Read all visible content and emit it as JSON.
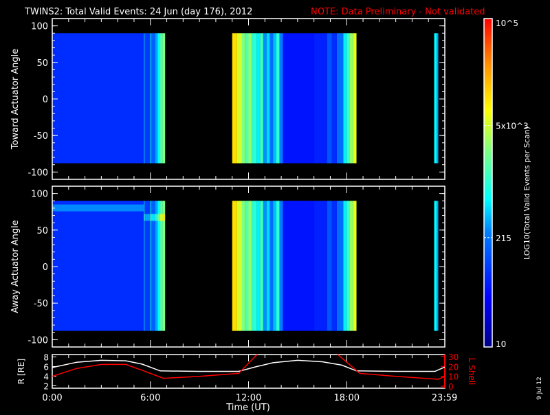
{
  "chart_data": {
    "type": "heatmap",
    "title": "TWINS2: Total Valid Events: 24 Jun (day 176), 2012",
    "note": "NOTE: Data Preliminary - Not validated",
    "xlabel": "Time (UT)",
    "x_ticks": [
      "0:00",
      "6:00",
      "12:00",
      "18:00",
      "23:59"
    ],
    "x_tick_hours": [
      0,
      6,
      12,
      18,
      23.98
    ],
    "xlim_hours": [
      0,
      24
    ],
    "panels": [
      {
        "ylabel": "Toward Actuator Angle",
        "ylim": [
          -110,
          110
        ],
        "y_ticks": [
          "100",
          "50",
          "0",
          "-50",
          "-100"
        ],
        "y_tick_values": [
          100,
          50,
          0,
          -50,
          -100
        ],
        "band": false
      },
      {
        "ylabel": "Away Actuator Angle",
        "ylim": [
          -110,
          110
        ],
        "y_ticks": [
          "100",
          "50",
          "0",
          "-50",
          "-100"
        ],
        "y_tick_values": [
          100,
          50,
          0,
          -50,
          -100
        ],
        "band": true
      }
    ],
    "angle_range": [
      -88,
      90
    ],
    "segments_hours_level": [
      [
        0,
        5.6,
        0.22
      ],
      [
        5.6,
        5.65,
        0.4
      ],
      [
        5.65,
        6.0,
        0.24
      ],
      [
        6.0,
        6.05,
        0.45
      ],
      [
        6.05,
        6.3,
        0.3
      ],
      [
        6.3,
        6.45,
        0.38
      ],
      [
        6.45,
        6.6,
        0.45
      ],
      [
        6.6,
        6.75,
        0.55
      ],
      [
        6.75,
        6.9,
        0.6
      ],
      [
        11.0,
        11.3,
        0.76
      ],
      [
        11.3,
        11.6,
        0.68
      ],
      [
        11.6,
        11.8,
        0.6
      ],
      [
        11.8,
        12.0,
        0.55
      ],
      [
        12.0,
        12.2,
        0.62
      ],
      [
        12.2,
        12.5,
        0.5
      ],
      [
        12.5,
        12.7,
        0.44
      ],
      [
        12.7,
        12.9,
        0.52
      ],
      [
        12.9,
        13.1,
        0.36
      ],
      [
        13.1,
        13.3,
        0.42
      ],
      [
        13.3,
        13.5,
        0.32
      ],
      [
        13.5,
        13.7,
        0.4
      ],
      [
        13.7,
        13.9,
        0.5
      ],
      [
        13.9,
        14.1,
        0.34
      ],
      [
        14.1,
        16.0,
        0.18
      ],
      [
        16.0,
        16.8,
        0.2
      ],
      [
        16.8,
        17.1,
        0.28
      ],
      [
        17.1,
        17.4,
        0.22
      ],
      [
        17.4,
        17.8,
        0.32
      ],
      [
        17.8,
        18.0,
        0.44
      ],
      [
        18.0,
        18.2,
        0.52
      ],
      [
        18.2,
        18.4,
        0.62
      ],
      [
        18.4,
        18.6,
        0.7
      ],
      [
        23.35,
        23.5,
        0.45
      ],
      [
        23.5,
        23.6,
        0.38
      ]
    ],
    "colorbar": {
      "label": "LOG10(Total Valid Events per Scan)",
      "range": [
        10,
        100000
      ],
      "ticks": [
        "10",
        "215",
        "5x10^3",
        "10^5"
      ],
      "tick_values": [
        10,
        215,
        5000,
        100000
      ],
      "scale": "log"
    },
    "orbit": {
      "left_label": "R [RE]",
      "right_label": "L Shell",
      "r_ticks": [
        "8",
        "6",
        "4",
        "2"
      ],
      "r_tick_values": [
        8,
        6,
        4,
        2
      ],
      "r_lim": [
        1.5,
        8.5
      ],
      "l_ticks": [
        "30",
        "20",
        "10",
        "0"
      ],
      "l_tick_values": [
        30,
        20,
        10,
        0
      ],
      "l_lim": [
        -2,
        32
      ],
      "R": {
        "hours": [
          0,
          1.5,
          3,
          4.5,
          5.5,
          6.6,
          9,
          11.4,
          12.5,
          13.5,
          15,
          16.5,
          17.7,
          18.6,
          21,
          23.4,
          24
        ],
        "values": [
          5.8,
          6.9,
          7.3,
          7.2,
          6.5,
          5.1,
          5.0,
          5.0,
          6.0,
          6.8,
          7.3,
          7.0,
          6.3,
          5.1,
          5.0,
          5.0,
          5.9
        ]
      },
      "L": {
        "hours": [
          0,
          1.5,
          3,
          4.5,
          5.5,
          6.8,
          9,
          11.4,
          12.4,
          12.6,
          null,
          17.4,
          17.6,
          18.8,
          21,
          23.6,
          24
        ],
        "values": [
          10,
          18,
          22,
          22,
          16,
          8,
          10,
          13,
          30,
          33,
          null,
          33,
          30,
          13,
          10,
          7,
          10
        ]
      }
    },
    "footer_date": "9 Jul 12"
  }
}
